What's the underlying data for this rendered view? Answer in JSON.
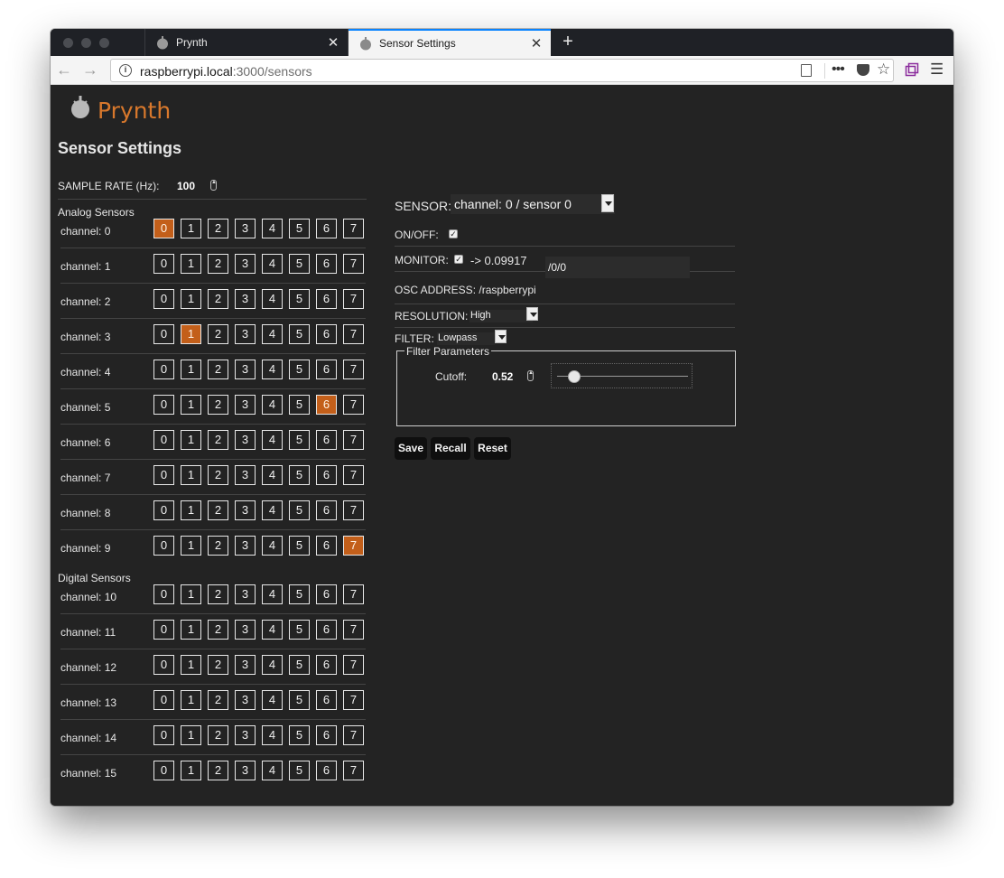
{
  "browser": {
    "tabs": [
      {
        "title": "Prynth",
        "active": false
      },
      {
        "title": "Sensor Settings",
        "active": true
      }
    ],
    "url_host": "raspberrypi.local",
    "url_rest": ":3000/sensors"
  },
  "page": {
    "logo_text": "Prynth",
    "title": "Sensor Settings",
    "sample_rate_label": "SAMPLE RATE (Hz):",
    "sample_rate_value": "100",
    "analog_label": "Analog Sensors",
    "digital_label": "Digital Sensors",
    "channel_buttons": [
      "0",
      "1",
      "2",
      "3",
      "4",
      "5",
      "6",
      "7"
    ],
    "analog_channels": [
      {
        "label": "channel: 0",
        "selected": 0
      },
      {
        "label": "channel: 1",
        "selected": -1
      },
      {
        "label": "channel: 2",
        "selected": -1
      },
      {
        "label": "channel: 3",
        "selected": 1
      },
      {
        "label": "channel: 4",
        "selected": -1
      },
      {
        "label": "channel: 5",
        "selected": 6
      },
      {
        "label": "channel: 6",
        "selected": -1
      },
      {
        "label": "channel: 7",
        "selected": -1
      },
      {
        "label": "channel: 8",
        "selected": -1
      },
      {
        "label": "channel: 9",
        "selected": 7
      }
    ],
    "digital_channels": [
      {
        "label": "channel: 10",
        "selected": -1
      },
      {
        "label": "channel: 11",
        "selected": -1
      },
      {
        "label": "channel: 12",
        "selected": -1
      },
      {
        "label": "channel: 13",
        "selected": -1
      },
      {
        "label": "channel: 14",
        "selected": -1
      },
      {
        "label": "channel: 15",
        "selected": -1
      }
    ]
  },
  "sensor_panel": {
    "sensor_label": "SENSOR:",
    "sensor_value": "channel: 0 / sensor 0",
    "onoff_label": "ON/OFF:",
    "onoff_checked": true,
    "monitor_label": "MONITOR:",
    "monitor_checked": true,
    "monitor_value": "-> 0.09917",
    "osc_label": "OSC ADDRESS: /raspberrypi",
    "osc_value": "/0/0",
    "resolution_label": "RESOLUTION:",
    "resolution_value": "High",
    "filter_label": "FILTER:",
    "filter_value": "Lowpass",
    "filter_params_legend": "Filter Parameters",
    "cutoff_label": "Cutoff:",
    "cutoff_value": "0.52",
    "cutoff_slider_fraction": 0.08,
    "save_label": "Save",
    "recall_label": "Recall",
    "reset_label": "Reset"
  },
  "colors": {
    "accent": "#c35f1a",
    "logo": "#d8782c",
    "background": "#232323",
    "active_tab_indicator": "#0a84ff"
  },
  "icons": [
    "prynth-knob-icon",
    "close-icon",
    "plus-icon",
    "back-arrow-icon",
    "forward-arrow-icon",
    "info-icon",
    "reader-view-icon",
    "more-icon",
    "pocket-icon",
    "bookmark-star-icon",
    "extension-icon",
    "hamburger-menu-icon",
    "checkbox-icon",
    "spinner-icon",
    "dropdown-arrow-icon"
  ]
}
